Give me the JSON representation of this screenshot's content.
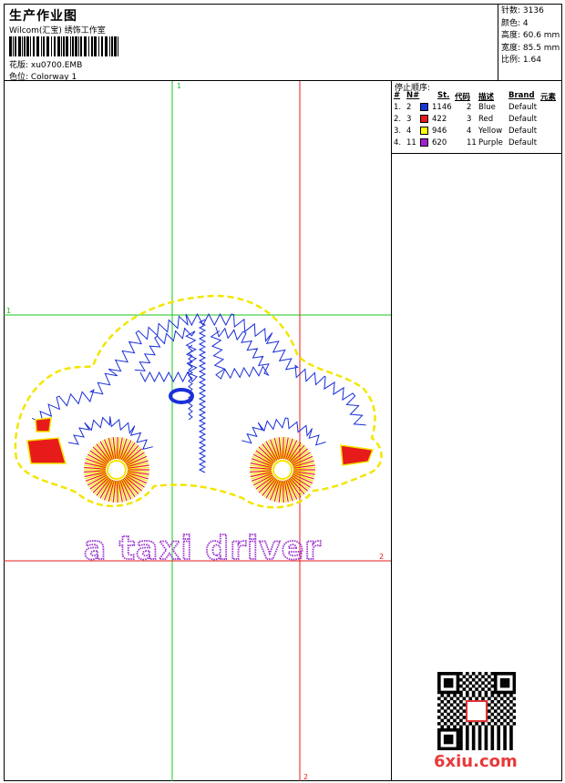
{
  "header": {
    "title": "生产作业图",
    "studio": "Wilcom(汇宝) 绣饰工作室",
    "design_label": "花版: xu0700.EMB",
    "colorway_label": "色位: Colorway 1"
  },
  "stats": {
    "stitches": "针数: 3136",
    "colors": "颜色: 4",
    "height": "高度: 60.6 mm",
    "width": "宽度: 85.5 mm",
    "scale": "比例: 1.64"
  },
  "stop_sequence": {
    "title": "停止顺序:",
    "headers": {
      "num": "#",
      "n": "N#",
      "st": "St.",
      "code": "代码",
      "desc": "描述",
      "brand": "Brand",
      "element": "元素"
    },
    "rows": [
      {
        "num": "1.",
        "n": "2",
        "color": "#1436d8",
        "st": "1146",
        "code": "2",
        "desc": "Blue",
        "brand": "Default"
      },
      {
        "num": "2.",
        "n": "3",
        "color": "#e8171b",
        "st": "422",
        "code": "3",
        "desc": "Red",
        "brand": "Default"
      },
      {
        "num": "3.",
        "n": "4",
        "color": "#ffff00",
        "st": "946",
        "code": "4",
        "desc": "Yellow",
        "brand": "Default"
      },
      {
        "num": "4.",
        "n": "11",
        "color": "#a31fd1",
        "st": "620",
        "code": "11",
        "desc": "Purple",
        "brand": "Default"
      }
    ]
  },
  "canvas": {
    "text": "a taxi driver",
    "guide_labels": {
      "v1": "1",
      "h1": "1",
      "v2": "2",
      "h2": "2"
    },
    "colors": {
      "blue": "#1a2fd8",
      "red": "#e81b1b",
      "yellow": "#f2e600",
      "purple": "#9b2fcf",
      "guide_green": "#18c418",
      "guide_red": "#e81b1b"
    }
  },
  "watermark": "6xiu.com"
}
